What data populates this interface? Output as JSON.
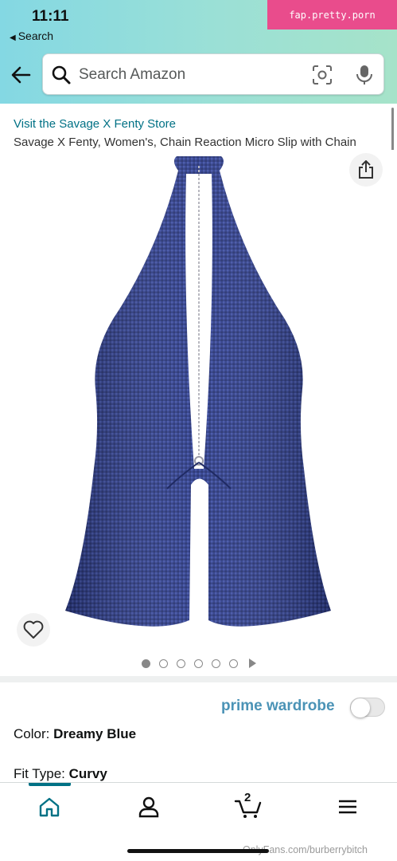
{
  "status": {
    "time": "11:11",
    "back_app": "Search"
  },
  "watermark_top": "fap.pretty.porn",
  "search": {
    "placeholder": "Search Amazon"
  },
  "product": {
    "store_link": "Visit the Savage X Fenty Store",
    "title": "Savage X Fenty, Women's, Chain Reaction Micro Slip with Chain",
    "image_alt": "blue sequin halter top with chain",
    "image_count": 6,
    "active_image": 1
  },
  "prime_wardrobe": {
    "label": "prime wardrobe",
    "enabled": false
  },
  "attributes": {
    "color_label": "Color:",
    "color_value": "Dreamy Blue",
    "fit_label": "Fit Type:",
    "fit_value": "Curvy"
  },
  "tabbar": {
    "cart_count": "2",
    "active": "home"
  },
  "watermark_bottom": "OnlyFans.com/burberrybitch",
  "colors": {
    "accent": "#007185",
    "prime": "#4b93b6",
    "header_gradient": "#84d8e3",
    "garment": "#2e3d8a"
  }
}
